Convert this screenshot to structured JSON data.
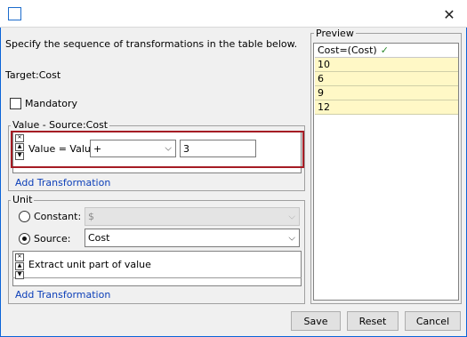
{
  "window": {
    "close_glyph": "✕"
  },
  "instructions": "Specify the sequence of transformations in the table below.",
  "target": "Target:Cost",
  "mandatory_label": "Mandatory",
  "value_group": {
    "legend": "Value - Source:Cost",
    "row_label": "Value = Value",
    "operator": "+",
    "operand": "3",
    "add_link": "Add Transformation"
  },
  "unit_group": {
    "legend": "Unit",
    "constant_label": "Constant:",
    "constant_value": "$",
    "source_label": "Source:",
    "source_value": "Cost",
    "transformation": "Extract unit part of value",
    "add_link": "Add Transformation"
  },
  "preview": {
    "legend": "Preview",
    "header": "Cost=(Cost)",
    "check_glyph": "✓",
    "rows": [
      "10",
      "6",
      "9",
      "12"
    ]
  },
  "buttons": {
    "save": "Save",
    "reset": "Reset",
    "cancel": "Cancel"
  },
  "colors": {
    "highlight_border": "#a51c24",
    "preview_row": "#fff8c6",
    "link": "#0b3eb8",
    "accent": "#0a64d8"
  }
}
